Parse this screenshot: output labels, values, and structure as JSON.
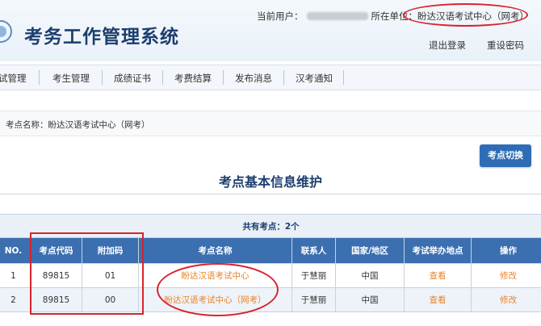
{
  "header": {
    "title": "考务工作管理系统",
    "current_user_label": "当前用户：",
    "org_label": "所在单位：",
    "org_name": "盼达汉语考试中心（网考）",
    "logout": "退出登录",
    "reset_password": "重设密码"
  },
  "nav": [
    {
      "label": "试管理"
    },
    {
      "label": "考生管理"
    },
    {
      "label": "成绩证书"
    },
    {
      "label": "考费结算"
    },
    {
      "label": "发布消息"
    },
    {
      "label": "汉考通知"
    }
  ],
  "breadcrumb": "考点名称：盼达汉语考试中心（网考）",
  "switch_button": "考点切换",
  "page_title": "考点基本信息维护",
  "table": {
    "summary": "共有考点：2个",
    "headers": [
      "NO.",
      "考点代码",
      "附加码",
      "考点名称",
      "联系人",
      "国家/地区",
      "考试举办地点",
      "操作"
    ],
    "rows": [
      {
        "no": "1",
        "code": "89815",
        "extra": "01",
        "name": "盼达汉语考试中心",
        "contact": "于慧丽",
        "country": "中国",
        "venue": "查看",
        "action": "修改"
      },
      {
        "no": "2",
        "code": "89815",
        "extra": "00",
        "name": "盼达汉语考试中心（网考）",
        "contact": "于慧丽",
        "country": "中国",
        "venue": "查看",
        "action": "修改"
      }
    ]
  },
  "colors": {
    "brand": "#1d3e6e",
    "table_header": "#3b6fb0",
    "link": "#e8842b",
    "annotation": "#d9232d"
  }
}
